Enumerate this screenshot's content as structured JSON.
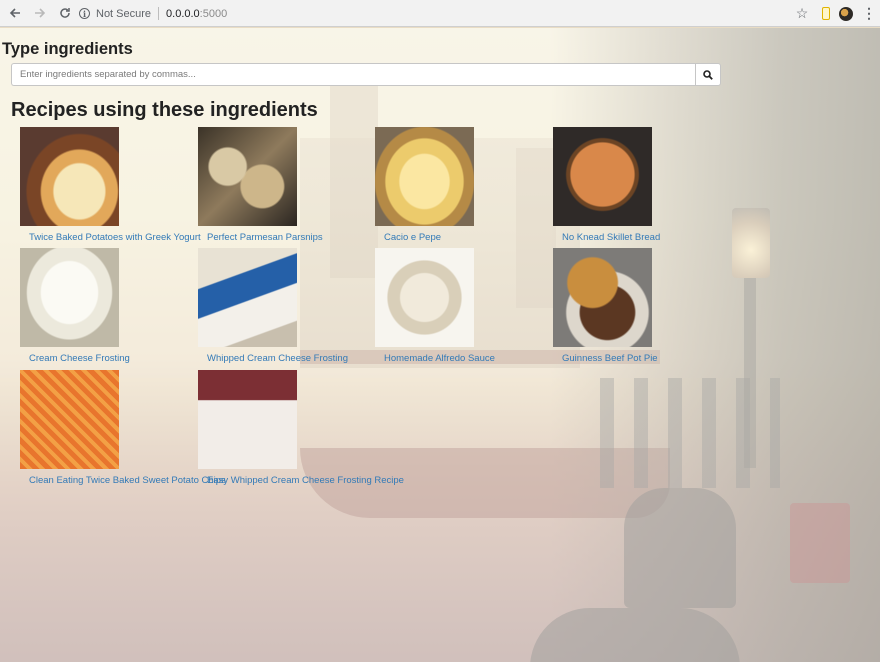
{
  "browser": {
    "security_label": "Not Secure",
    "url_host": "0.0.0.0",
    "url_port": ":5000"
  },
  "page": {
    "heading_type": "Type ingredients",
    "search": {
      "placeholder": "Enter ingredients separated by commas..."
    },
    "heading_recipes": "Recipes using these ingredients",
    "link_color": "#337ab7"
  },
  "recipes": [
    {
      "title": "Twice Baked Potatoes with Greek Yogurt",
      "thumb": "potato"
    },
    {
      "title": "Perfect Parmesan Parsnips",
      "thumb": "parsnip"
    },
    {
      "title": "Cacio e Pepe",
      "thumb": "cacio"
    },
    {
      "title": "No Knead Skillet Bread",
      "thumb": "bread"
    },
    {
      "title": "Cream Cheese Frosting",
      "thumb": "frosting"
    },
    {
      "title": "Whipped Cream Cheese Frosting",
      "thumb": "whipped"
    },
    {
      "title": "Homemade Alfredo Sauce",
      "thumb": "alfredo"
    },
    {
      "title": "Guinness Beef Pot Pie",
      "thumb": "guinness"
    },
    {
      "title": "Clean Eating Twice Baked Sweet Potato Chips",
      "thumb": "sweetpotato"
    },
    {
      "title": "Easy Whipped Cream Cheese Frosting Recipe",
      "thumb": "whipped2"
    }
  ]
}
